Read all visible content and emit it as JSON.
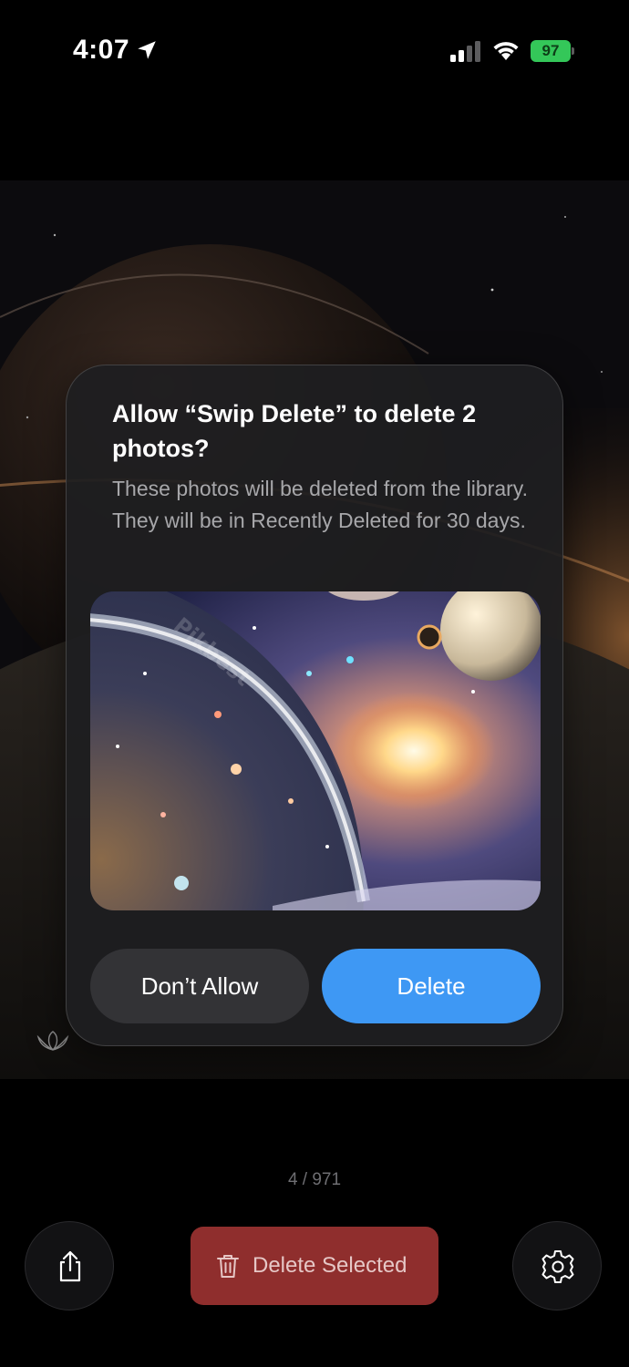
{
  "status_bar": {
    "time": "4:07",
    "battery": "97",
    "icons": [
      "location-arrow-icon",
      "cellular-signal-icon",
      "wifi-icon",
      "battery-charging-icon"
    ]
  },
  "alert": {
    "title": "Allow “Swip Delete” to delete 2 photos?",
    "message": "These photos will be deleted from the library. They will be in Recently Deleted for 30 days.",
    "image_watermark": "Pikbest",
    "buttons": {
      "dont_allow": "Don’t Allow",
      "delete": "Delete"
    }
  },
  "counter": "4 / 971",
  "bottom_bar": {
    "delete_selected": "Delete Selected",
    "share_icon": "share-icon",
    "settings_icon": "gear-icon",
    "trash_icon": "trash-icon"
  },
  "colors": {
    "delete_button": "#3e98f4",
    "delete_selected_bg": "#8f2e2d",
    "battery": "#34c759"
  }
}
